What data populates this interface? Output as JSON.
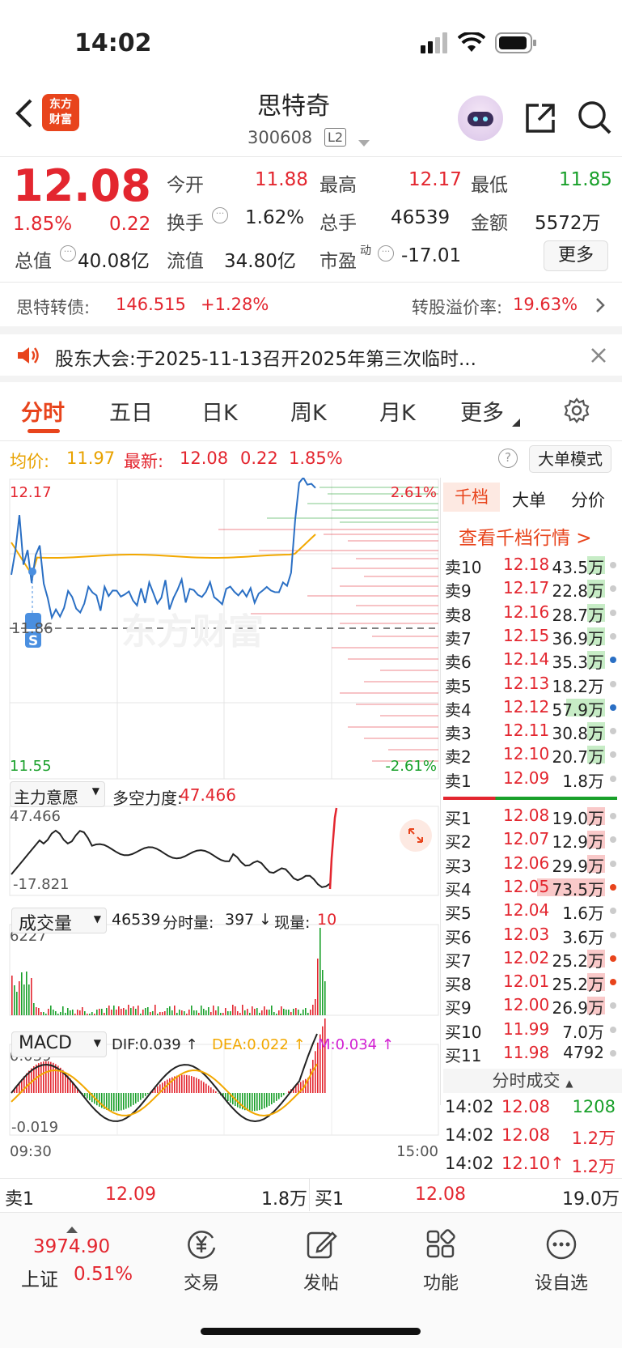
{
  "status_bar": {
    "time": "14:02"
  },
  "header": {
    "title": "思特奇",
    "code": "300608",
    "level_badge": "L2",
    "logo_line1": "东方",
    "logo_line2": "财富"
  },
  "quote": {
    "price": "12.08",
    "pct": "1.85%",
    "change": "0.22",
    "open_label": "今开",
    "open": "11.88",
    "high_label": "最高",
    "high": "12.17",
    "low_label": "最低",
    "low": "11.85",
    "turnover_label": "换手",
    "turnover": "1.62%",
    "volume_label": "总手",
    "volume": "46539",
    "amount_label": "金额",
    "amount": "5572万",
    "mktcap_label": "总值",
    "mktcap": "40.08亿",
    "float_label": "流值",
    "float": "34.80亿",
    "pe_label": "市盈",
    "pe_sup": "动",
    "pe": "-17.01",
    "more_button": "更多"
  },
  "bond": {
    "name": "思特转债:",
    "price": "146.515",
    "pct": "+1.28%",
    "premium_label": "转股溢价率:",
    "premium": "19.63%"
  },
  "notice": {
    "text": "股东大会:于2025-11-13召开2025年第三次临时..."
  },
  "tabs": [
    "分时",
    "五日",
    "日K",
    "周K",
    "月K",
    "更多"
  ],
  "chart_header": {
    "avg_label": "均价:",
    "avg": "11.97",
    "latest_label": "最新:",
    "latest": "12.08",
    "change": "0.22",
    "pct": "1.85%",
    "mode_button": "大单模式"
  },
  "price_axis": {
    "top": "12.17",
    "mid": "11.86",
    "bottom": "11.55",
    "top_pct": "2.61%",
    "bottom_pct": "-2.61%"
  },
  "strength": {
    "selector": "主力意愿",
    "label": "多空力度:",
    "value": "47.466",
    "top": "47.466",
    "bottom": "-17.821"
  },
  "volume_panel": {
    "selector": "成交量",
    "total": "46539",
    "minute_label": "分时量:",
    "minute": "397",
    "arrow": "↓",
    "now_label": "现量:",
    "now": "10",
    "top": "6227"
  },
  "macd": {
    "selector": "MACD",
    "dif": "DIF:0.039 ↑",
    "dea": "DEA:0.022 ↑",
    "m": "M:0.034 ↑",
    "top": "0.039",
    "bottom": "-0.019"
  },
  "time_axis": {
    "start": "09:30",
    "end": "15:00"
  },
  "orderbook_tabs": [
    "千档",
    "大单",
    "分价"
  ],
  "orderbook_link": "查看千档行情 >",
  "asks": [
    {
      "label": "卖10",
      "price": "12.18",
      "vol": "43.5万"
    },
    {
      "label": "卖9",
      "price": "12.17",
      "vol": "22.8万"
    },
    {
      "label": "卖8",
      "price": "12.16",
      "vol": "28.7万"
    },
    {
      "label": "卖7",
      "price": "12.15",
      "vol": "36.9万"
    },
    {
      "label": "卖6",
      "price": "12.14",
      "vol": "35.3万"
    },
    {
      "label": "卖5",
      "price": "12.13",
      "vol": "18.2万"
    },
    {
      "label": "卖4",
      "price": "12.12",
      "vol": "57.9万"
    },
    {
      "label": "卖3",
      "price": "12.11",
      "vol": "30.8万"
    },
    {
      "label": "卖2",
      "price": "12.10",
      "vol": "20.7万"
    },
    {
      "label": "卖1",
      "price": "12.09",
      "vol": "1.8万"
    }
  ],
  "bids": [
    {
      "label": "买1",
      "price": "12.08",
      "vol": "19.0万"
    },
    {
      "label": "买2",
      "price": "12.07",
      "vol": "12.9万"
    },
    {
      "label": "买3",
      "price": "12.06",
      "vol": "29.9万"
    },
    {
      "label": "买4",
      "price": "12.05",
      "vol": "73.5万"
    },
    {
      "label": "买5",
      "price": "12.04",
      "vol": "1.6万"
    },
    {
      "label": "买6",
      "price": "12.03",
      "vol": "3.6万"
    },
    {
      "label": "买7",
      "price": "12.02",
      "vol": "25.2万"
    },
    {
      "label": "买8",
      "price": "12.01",
      "vol": "25.2万"
    },
    {
      "label": "买9",
      "price": "12.00",
      "vol": "26.9万"
    },
    {
      "label": "买10",
      "price": "11.99",
      "vol": "7.0万"
    },
    {
      "label": "买11",
      "price": "11.98",
      "vol": "4792"
    }
  ],
  "trades_header": "分时成交",
  "trades": [
    {
      "time": "14:02",
      "price": "12.08",
      "vol": "1208"
    },
    {
      "time": "14:02",
      "price": "12.08",
      "vol": "1.2万"
    },
    {
      "time": "14:02",
      "price": "12.10↑",
      "vol": "1.2万"
    }
  ],
  "level1": {
    "ask_label": "卖1",
    "ask_price": "12.09",
    "ask_vol": "1.8万",
    "bid_label": "买1",
    "bid_price": "12.08",
    "bid_vol": "19.0万"
  },
  "bottom_bar": {
    "index_value": "3974.90",
    "index_name": "上证",
    "index_pct": "0.51%",
    "trade": "交易",
    "post": "发帖",
    "function": "功能",
    "watchlist": "设自选"
  }
}
